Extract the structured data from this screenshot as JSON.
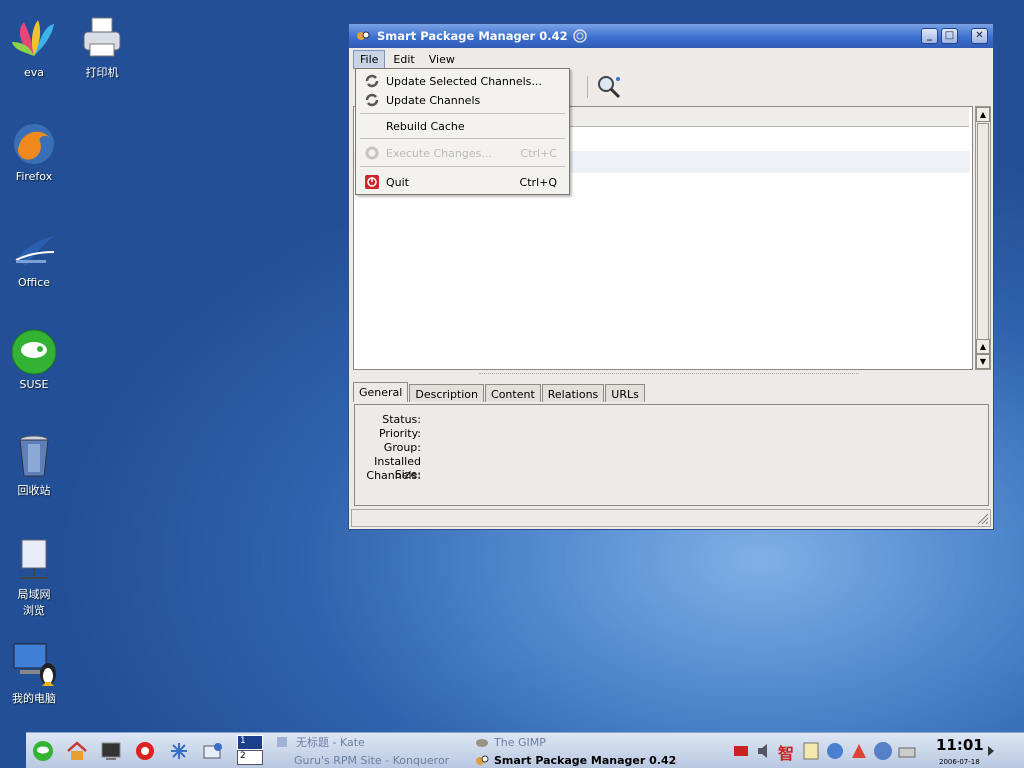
{
  "desktop_icons": [
    {
      "label": "eva",
      "icon": "eva-icon"
    },
    {
      "label": "打印机",
      "icon": "printer-icon"
    },
    {
      "label": "Firefox",
      "icon": "firefox-icon"
    },
    {
      "label": "Office",
      "icon": "office-icon"
    },
    {
      "label": "SUSE",
      "icon": "suse-icon"
    },
    {
      "label": "回收站",
      "icon": "trash-icon"
    },
    {
      "label": "局域网\n浏览",
      "icon": "network-icon"
    },
    {
      "label": "我的电脑",
      "icon": "my-computer-icon"
    }
  ],
  "window": {
    "title": "Smart Package Manager 0.42",
    "menubar": [
      "File",
      "Edit",
      "View"
    ],
    "tabs": [
      "General",
      "Description",
      "Content",
      "Relations",
      "URLs"
    ],
    "info_fields": [
      "Status:",
      "Priority:",
      "Group:",
      "Installed Size:",
      "Channels:"
    ]
  },
  "file_menu": {
    "items": [
      {
        "label": "Update Selected Channels...",
        "shortcut": "",
        "enabled": true,
        "icon": "update-icon"
      },
      {
        "label": "Update Channels",
        "shortcut": "",
        "enabled": true,
        "icon": "update-icon"
      },
      {
        "label": "Rebuild Cache",
        "shortcut": "",
        "enabled": true,
        "icon": ""
      },
      {
        "label": "Execute Changes...",
        "shortcut": "Ctrl+C",
        "enabled": false,
        "icon": "execute-icon"
      },
      {
        "label": "Quit",
        "shortcut": "Ctrl+Q",
        "enabled": true,
        "icon": "quit-icon"
      }
    ]
  },
  "taskbar": {
    "pager": [
      "1",
      "2"
    ],
    "tasks": [
      {
        "label": "无标题 - Kate",
        "active": false
      },
      {
        "label": "Guru's RPM Site - Konqueror",
        "active": false
      },
      {
        "label": "The GIMP",
        "active": false
      },
      {
        "label": "Smart Package Manager 0.42",
        "active": true
      }
    ],
    "tray_text": "智",
    "clock": "11:01",
    "date": "2006-07-18"
  },
  "colors": {
    "titlebar": "#3d6fcf",
    "desktop": "#2f63ad",
    "taskbar": "#c8d4ea"
  }
}
